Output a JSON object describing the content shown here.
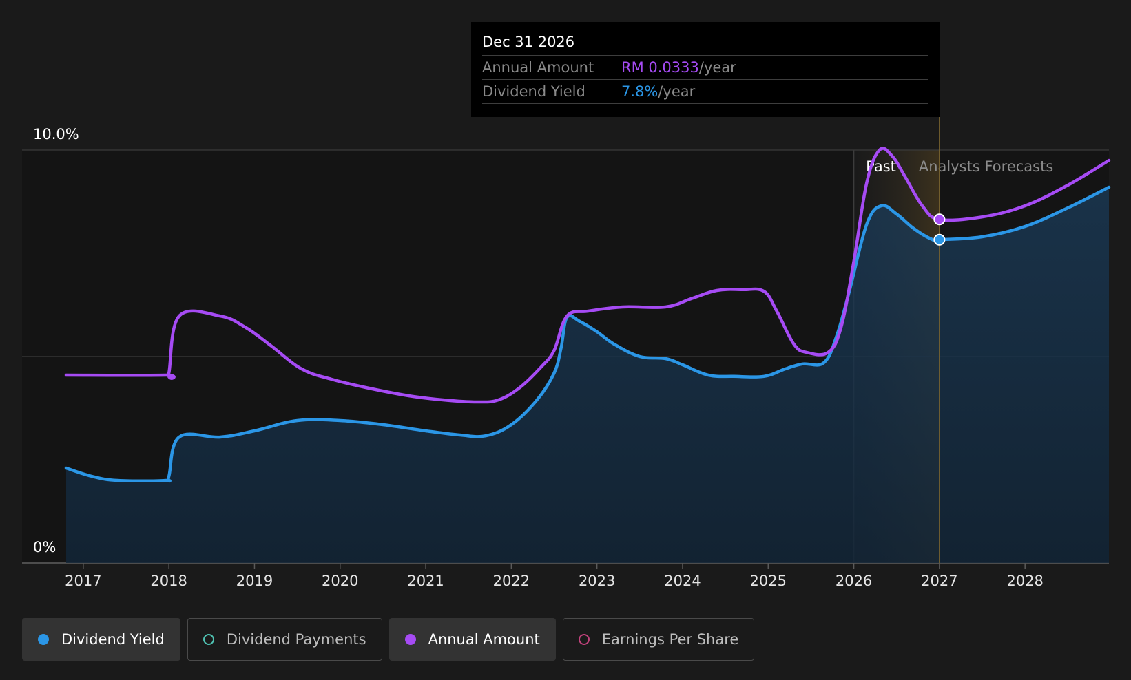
{
  "tooltip": {
    "date": "Dec 31 2026",
    "rows": [
      {
        "label": "Annual Amount",
        "value": "RM 0.0333",
        "unit": "/year",
        "color": "#a64bf4"
      },
      {
        "label": "Dividend Yield",
        "value": "7.8%",
        "unit": "/year",
        "color": "#2b96e6"
      }
    ]
  },
  "legend": [
    {
      "label": "Dividend Yield",
      "color": "#2b96e6",
      "style": "filled",
      "active": true
    },
    {
      "label": "Dividend Payments",
      "color": "#4fc3b3",
      "style": "hollow",
      "active": false
    },
    {
      "label": "Annual Amount",
      "color": "#a64bf4",
      "style": "filled",
      "active": true
    },
    {
      "label": "Earnings Per Share",
      "color": "#c2427c",
      "style": "hollow",
      "active": false
    }
  ],
  "chart_data": {
    "type": "line",
    "y_tick_labels": [
      "0%",
      "10.0%"
    ],
    "ylim": [
      0,
      10
    ],
    "xlim": [
      2016.8,
      2028.98
    ],
    "x_ticks": [
      2017,
      2018,
      2019,
      2020,
      2021,
      2022,
      2023,
      2024,
      2025,
      2026,
      2027,
      2028
    ],
    "x_tick_labels": [
      "2017",
      "2018",
      "2019",
      "2020",
      "2021",
      "2022",
      "2023",
      "2024",
      "2025",
      "2026",
      "2027",
      "2028"
    ],
    "grid": {
      "horizontal": [
        0,
        5,
        10
      ]
    },
    "regions": [
      {
        "label": "Past",
        "from": 2026.0,
        "to": 2027.0
      },
      {
        "label": "Analysts Forecasts",
        "from": 2027.0,
        "to": 2028.98
      }
    ],
    "highlight_x": 2027.0,
    "series": [
      {
        "name": "Dividend Yield",
        "color": "#2b96e6",
        "filled": true,
        "points": [
          [
            2016.8,
            2.3
          ],
          [
            2017.1,
            2.1
          ],
          [
            2017.4,
            2.0
          ],
          [
            2017.96,
            2.0
          ],
          [
            2018.0,
            2.1
          ],
          [
            2018.12,
            3.05
          ],
          [
            2018.6,
            3.05
          ],
          [
            2019.0,
            3.2
          ],
          [
            2019.5,
            3.45
          ],
          [
            2020.0,
            3.45
          ],
          [
            2020.5,
            3.35
          ],
          [
            2021.0,
            3.2
          ],
          [
            2021.4,
            3.1
          ],
          [
            2021.7,
            3.08
          ],
          [
            2022.0,
            3.35
          ],
          [
            2022.3,
            3.95
          ],
          [
            2022.5,
            4.6
          ],
          [
            2022.58,
            5.2
          ],
          [
            2022.65,
            5.95
          ],
          [
            2022.8,
            5.85
          ],
          [
            2023.0,
            5.6
          ],
          [
            2023.2,
            5.3
          ],
          [
            2023.5,
            5.0
          ],
          [
            2023.8,
            4.95
          ],
          [
            2024.0,
            4.8
          ],
          [
            2024.3,
            4.55
          ],
          [
            2024.6,
            4.52
          ],
          [
            2024.95,
            4.52
          ],
          [
            2025.2,
            4.7
          ],
          [
            2025.4,
            4.82
          ],
          [
            2025.65,
            4.85
          ],
          [
            2025.8,
            5.5
          ],
          [
            2025.95,
            6.6
          ],
          [
            2026.15,
            8.2
          ],
          [
            2026.32,
            8.65
          ],
          [
            2026.5,
            8.45
          ],
          [
            2026.7,
            8.1
          ],
          [
            2026.9,
            7.85
          ],
          [
            2027.0,
            7.83
          ],
          [
            2027.5,
            7.9
          ],
          [
            2028.0,
            8.15
          ],
          [
            2028.5,
            8.6
          ],
          [
            2028.98,
            9.1
          ]
        ]
      },
      {
        "name": "Annual Amount",
        "color": "#a64bf4",
        "filled": false,
        "points": [
          [
            2016.8,
            4.55
          ],
          [
            2017.96,
            4.55
          ],
          [
            2018.0,
            4.6
          ],
          [
            2018.12,
            5.98
          ],
          [
            2018.6,
            5.98
          ],
          [
            2018.9,
            5.7
          ],
          [
            2019.2,
            5.25
          ],
          [
            2019.55,
            4.7
          ],
          [
            2019.9,
            4.45
          ],
          [
            2020.3,
            4.25
          ],
          [
            2020.8,
            4.05
          ],
          [
            2021.2,
            3.95
          ],
          [
            2021.6,
            3.9
          ],
          [
            2021.85,
            3.95
          ],
          [
            2022.1,
            4.25
          ],
          [
            2022.35,
            4.75
          ],
          [
            2022.5,
            5.15
          ],
          [
            2022.65,
            5.98
          ],
          [
            2022.9,
            6.1
          ],
          [
            2023.3,
            6.2
          ],
          [
            2023.8,
            6.2
          ],
          [
            2024.1,
            6.4
          ],
          [
            2024.4,
            6.6
          ],
          [
            2024.7,
            6.62
          ],
          [
            2024.95,
            6.58
          ],
          [
            2025.1,
            6.1
          ],
          [
            2025.3,
            5.3
          ],
          [
            2025.45,
            5.1
          ],
          [
            2025.7,
            5.1
          ],
          [
            2025.85,
            5.7
          ],
          [
            2026.0,
            7.3
          ],
          [
            2026.15,
            9.2
          ],
          [
            2026.3,
            10.0
          ],
          [
            2026.45,
            9.85
          ],
          [
            2026.6,
            9.35
          ],
          [
            2026.8,
            8.65
          ],
          [
            2027.0,
            8.32
          ],
          [
            2027.5,
            8.38
          ],
          [
            2028.0,
            8.65
          ],
          [
            2028.5,
            9.15
          ],
          [
            2028.98,
            9.75
          ]
        ]
      }
    ]
  }
}
